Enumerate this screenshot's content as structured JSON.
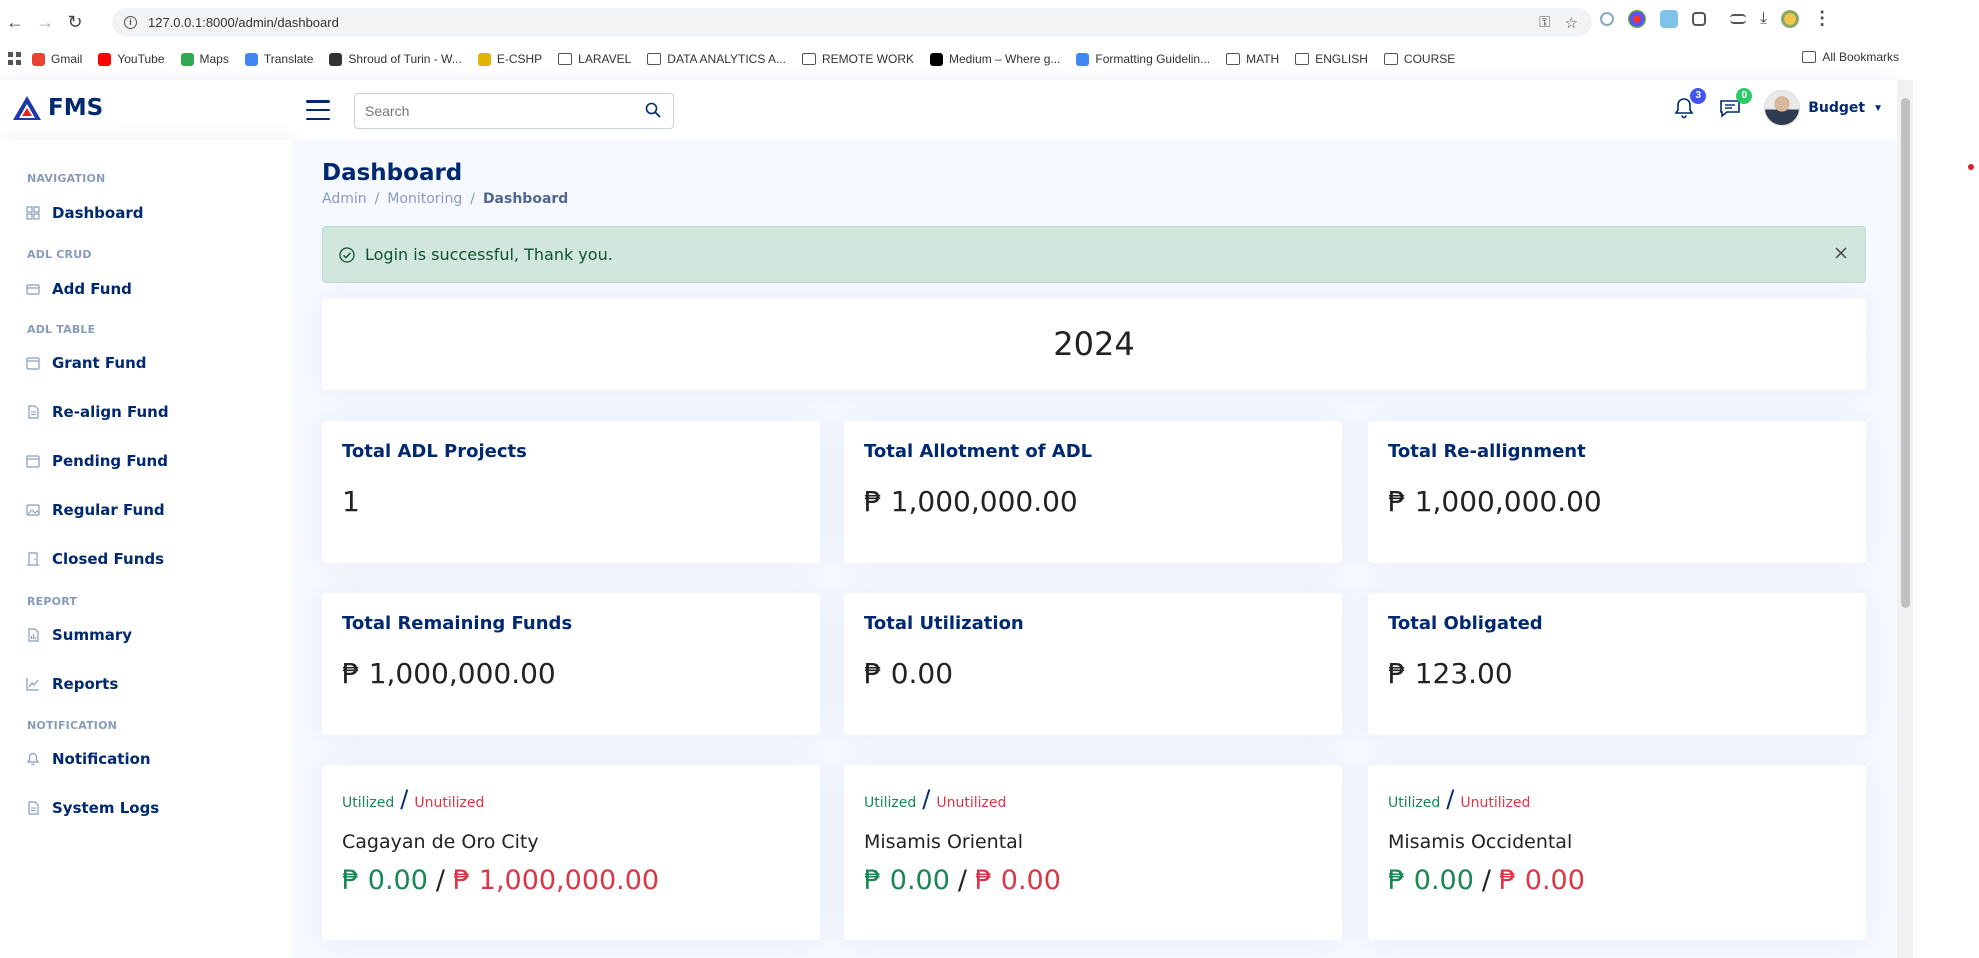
{
  "browser": {
    "url": "127.0.0.1:8000/admin/dashboard",
    "bookmarks": [
      {
        "label": "Gmail",
        "icon": "gmail-icon",
        "color": "#ea4335"
      },
      {
        "label": "YouTube",
        "icon": "youtube-icon",
        "color": "#ff0000"
      },
      {
        "label": "Maps",
        "icon": "maps-icon",
        "color": "#34a853"
      },
      {
        "label": "Translate",
        "icon": "translate-icon",
        "color": "#4285f4"
      },
      {
        "label": "Shroud of Turin - W...",
        "icon": "wikipedia-icon",
        "color": "#333333"
      },
      {
        "label": "E-CSHP",
        "icon": "ecshp-icon",
        "color": "#e3b400"
      },
      {
        "label": "LARAVEL",
        "icon": "folder-icon",
        "color": "#555555"
      },
      {
        "label": "DATA ANALYTICS A...",
        "icon": "folder-icon",
        "color": "#555555"
      },
      {
        "label": "REMOTE WORK",
        "icon": "folder-icon",
        "color": "#555555"
      },
      {
        "label": "Medium – Where g...",
        "icon": "medium-icon",
        "color": "#000000"
      },
      {
        "label": "Formatting Guidelin...",
        "icon": "docs-icon",
        "color": "#4285f4"
      },
      {
        "label": "MATH",
        "icon": "folder-icon",
        "color": "#555555"
      },
      {
        "label": "ENGLISH",
        "icon": "folder-icon",
        "color": "#555555"
      },
      {
        "label": "COURSE",
        "icon": "folder-icon",
        "color": "#555555"
      }
    ],
    "all_bookmarks": "All Bookmarks"
  },
  "app": {
    "logo_text": "FMS",
    "search_placeholder": "Search",
    "notifications_count": "3",
    "messages_count": "0",
    "profile_name": "Budget"
  },
  "sidebar": {
    "sections": {
      "navigation": "Navigation",
      "adl_crud": "ADL CRUD",
      "adl_table": "ADL TABLE",
      "report": "REPORT",
      "notification": "NOTIFICATION"
    },
    "items": {
      "dashboard": "Dashboard",
      "add_fund": "Add Fund",
      "grant_fund": "Grant Fund",
      "realign_fund": "Re-align Fund",
      "pending_fund": "Pending Fund",
      "regular_fund": "Regular Fund",
      "closed_funds": "Closed Funds",
      "summary": "Summary",
      "reports": "Reports",
      "notification": "Notification",
      "system_logs": "System Logs"
    }
  },
  "page": {
    "title": "Dashboard",
    "breadcrumb": [
      "Admin",
      "Monitoring",
      "Dashboard"
    ],
    "alert": "Login is successful, Thank you.",
    "year": "2024"
  },
  "stats": [
    {
      "title": "Total ADL Projects",
      "value": "1"
    },
    {
      "title": "Total Allotment of ADL",
      "value": "₱ 1,000,000.00"
    },
    {
      "title": "Total Re-allignment",
      "value": "₱ 1,000,000.00"
    },
    {
      "title": "Total Remaining Funds",
      "value": "₱ 1,000,000.00"
    },
    {
      "title": "Total Utilization",
      "value": "₱ 0.00"
    },
    {
      "title": "Total Obligated",
      "value": "₱ 123.00"
    }
  ],
  "utilization_header": {
    "utilized": "Utilized",
    "separator": "/",
    "unutilized": "Unutilized"
  },
  "locations": [
    {
      "name": "Cagayan de Oro City",
      "utilized": "₱ 0.00",
      "unutilized": "₱ 1,000,000.00"
    },
    {
      "name": "Misamis Oriental",
      "utilized": "₱ 0.00",
      "unutilized": "₱ 0.00"
    },
    {
      "name": "Misamis Occidental",
      "utilized": "₱ 0.00",
      "unutilized": "₱ 0.00"
    }
  ],
  "colors": {
    "brand": "#012970",
    "accent": "#4154f1",
    "success": "#198754",
    "danger": "#dc3545",
    "alert_bg": "#d1e7dd"
  }
}
